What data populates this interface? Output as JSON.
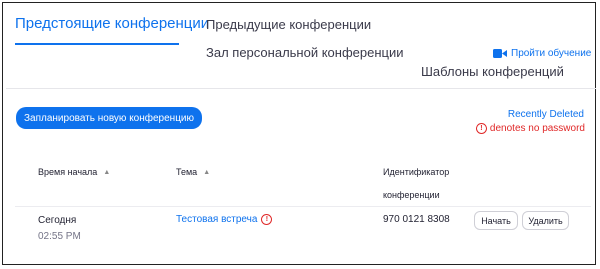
{
  "tabs": {
    "upcoming": "Предстоящие конференции",
    "previous": "Предыдущие конференции",
    "personal_room": "Зал персональной конференции",
    "templates": "Шаблоны конференций"
  },
  "training_link": {
    "label": "Пройти обучение",
    "icon": "video-camera-icon"
  },
  "schedule_button": "Запланировать новую конференцию",
  "recently_deleted": "Recently Deleted",
  "password_note": {
    "text": "denotes no password",
    "icon": "alert-circle-icon"
  },
  "table": {
    "columns": {
      "start_time": "Время начала",
      "topic": "Тема",
      "meeting_id_line1": "Идентификатор",
      "meeting_id_line2": "конференции"
    },
    "rows": [
      {
        "day": "Сегодня",
        "time": "02:55 PM",
        "topic": "Тестовая встреча",
        "meeting_id": "970 0121 8308",
        "start_label": "Начать",
        "delete_label": "Удалить"
      }
    ]
  },
  "colors": {
    "accent": "#0e72ed",
    "warning": "#e02828",
    "text": "#232333",
    "muted": "#747487"
  }
}
